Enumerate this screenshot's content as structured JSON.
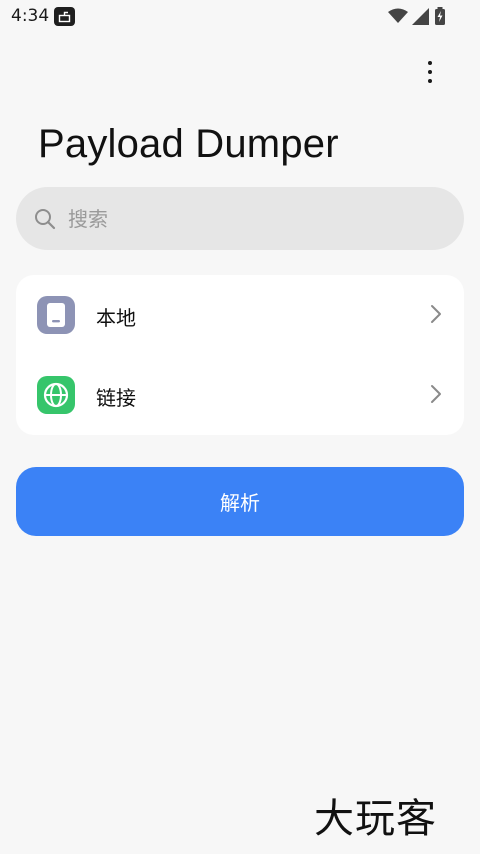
{
  "status_bar": {
    "time": "4:34",
    "icons": [
      "notification-icon",
      "wifi-icon",
      "signal-icon",
      "battery-charging-icon"
    ]
  },
  "header": {
    "title": "Payload Dumper",
    "menu_icon": "more-vert-icon"
  },
  "search": {
    "placeholder": "搜索",
    "value": "",
    "icon": "search-icon"
  },
  "sources": {
    "items": [
      {
        "label": "本地",
        "icon": "tablet-icon",
        "color": "#8d93b5"
      },
      {
        "label": "链接",
        "icon": "globe-icon",
        "color": "#36c56b"
      }
    ]
  },
  "actions": {
    "parse_label": "解析",
    "accent": "#3b82f6"
  },
  "watermark": {
    "text": "大玩客"
  }
}
